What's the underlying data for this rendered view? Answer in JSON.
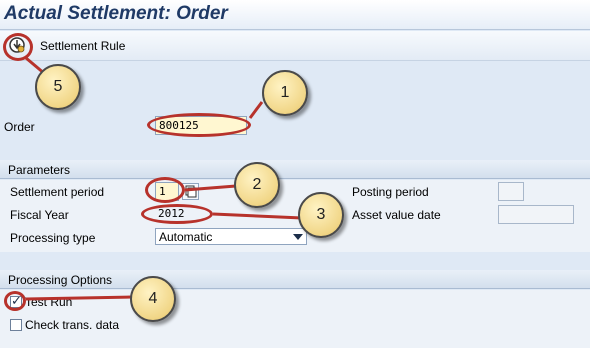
{
  "title": "Actual Settlement: Order",
  "toolbar": {
    "settlement_rule": "Settlement Rule",
    "icon": "settlement-rule-icon"
  },
  "order": {
    "label": "Order",
    "value": "800125"
  },
  "parameters": {
    "heading": "Parameters",
    "settlement_period": {
      "label": "Settlement period",
      "value": "1"
    },
    "fiscal_year": {
      "label": "Fiscal Year",
      "value": "2012"
    },
    "processing_type": {
      "label": "Processing type",
      "value": "Automatic"
    },
    "posting_period": {
      "label": "Posting period",
      "value": ""
    },
    "asset_value_date": {
      "label": "Asset value date",
      "value": ""
    }
  },
  "processing_options": {
    "heading": "Processing Options",
    "test_run": {
      "label": "Test Run",
      "checked": true
    },
    "check_trans": {
      "label": "Check trans. data",
      "checked": false
    }
  },
  "callouts": [
    "1",
    "2",
    "3",
    "4",
    "5"
  ],
  "colors": {
    "highlight": "#b7322b",
    "callout_fill": "#f1d687"
  }
}
